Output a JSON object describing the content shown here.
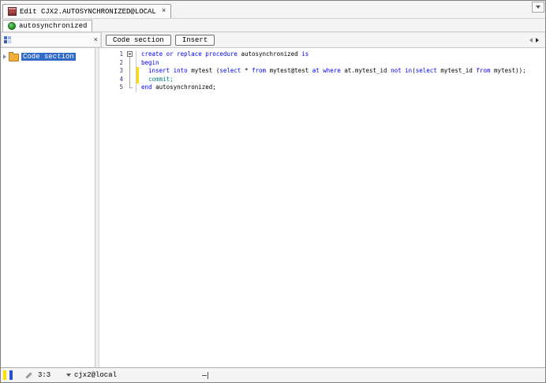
{
  "window": {
    "tab_title": "Edit CJX2.AUTOSYNCHRONIZED@LOCAL",
    "tab_close": "×"
  },
  "doc_tab": {
    "label": "autosynchronized"
  },
  "panel": {
    "close": "×"
  },
  "toolbar": {
    "buttons": [
      {
        "label": "Code section"
      },
      {
        "label": "Insert"
      }
    ]
  },
  "tree": {
    "items": [
      {
        "label": "Code section",
        "selected": true
      }
    ]
  },
  "editor": {
    "colors": {
      "kw": "#0000ff",
      "id": "#000000",
      "bi": "#008080"
    },
    "line_number_color": "#3b3b85",
    "modified_marker_color": "#ffdf00",
    "lines": [
      {
        "num": "1",
        "fold": "collapse",
        "marker": false,
        "segments": [
          {
            "t": "kw",
            "s": "create or replace procedure "
          },
          {
            "t": "id",
            "s": "autosynchronized "
          },
          {
            "t": "kw",
            "s": "is"
          }
        ]
      },
      {
        "num": "2",
        "fold": "line",
        "marker": false,
        "segments": [
          {
            "t": "kw",
            "s": "begin"
          }
        ]
      },
      {
        "num": "3",
        "fold": "line",
        "marker": true,
        "segments": [
          {
            "t": "id",
            "s": "  "
          },
          {
            "t": "kw",
            "s": "insert into "
          },
          {
            "t": "id",
            "s": "mytest ("
          },
          {
            "t": "kw",
            "s": "select "
          },
          {
            "t": "id",
            "s": "* "
          },
          {
            "t": "kw",
            "s": "from "
          },
          {
            "t": "id",
            "s": "mytest@test "
          },
          {
            "t": "kw",
            "s": "at where "
          },
          {
            "t": "id",
            "s": "at.mytest_id "
          },
          {
            "t": "kw",
            "s": "not in"
          },
          {
            "t": "id",
            "s": "("
          },
          {
            "t": "kw",
            "s": "select "
          },
          {
            "t": "id",
            "s": "mytest_id "
          },
          {
            "t": "kw",
            "s": "from "
          },
          {
            "t": "id",
            "s": "mytest));"
          }
        ]
      },
      {
        "num": "4",
        "fold": "line",
        "marker": true,
        "segments": [
          {
            "t": "id",
            "s": "  "
          },
          {
            "t": "bi",
            "s": "commit;"
          }
        ]
      },
      {
        "num": "5",
        "fold": "end",
        "marker": false,
        "segments": [
          {
            "t": "kw",
            "s": "end "
          },
          {
            "t": "id",
            "s": "autosynchronized;"
          }
        ]
      }
    ]
  },
  "statusbar": {
    "cursor_position": "3:3",
    "connection": "cjx2@local"
  }
}
